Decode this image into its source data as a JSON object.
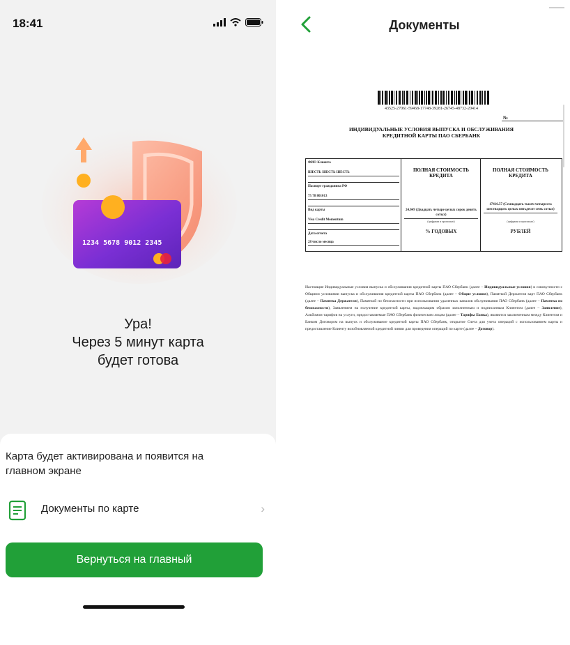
{
  "left_screen": {
    "status_bar": {
      "time": "18:41"
    },
    "hero": {
      "card_number": "1234  5678  9012  2345"
    },
    "headline": {
      "line1": "Ура!",
      "line2": "Через 5 минут карта",
      "line3": "будет готова"
    },
    "sheet": {
      "activation_text": "Карта будет активирована и появится на главном экране",
      "documents_label": "Документы по карте",
      "documents_chevron": "›",
      "cta_label": "Вернуться на главный"
    },
    "colors": {
      "accent": "#21a038",
      "background": "#f2f2f2"
    }
  },
  "right_screen": {
    "nav": {
      "back_icon": "‹",
      "title": "Документы"
    },
    "document": {
      "barcode_number": "43525-27061-59468-17748-39281-26745-48732-20414",
      "number_label": "№",
      "title_line1": "ИНДИВИДУАЛЬНЫЕ УСЛОВИЯ ВЫПУСКА И ОБСЛУЖИВАНИЯ",
      "title_line2": "КРЕДИТНОЙ КАРТЫ ПАО СБЕРБАНК",
      "fields": [
        {
          "key": "ФИО Клиента",
          "value": "ШЕСТЬ ШЕСТЬ ШЕСТЬ"
        },
        {
          "key": "Паспорт гражданина РФ",
          "value": "75 78 801013"
        },
        {
          "key": "Вид карты",
          "value": "Visa Credit Momentum"
        },
        {
          "key": "Дата отчета",
          "value": "28 число месяца"
        }
      ],
      "cost_percent": {
        "header": "ПОЛНАЯ СТОИМОСТЬ КРЕДИТА",
        "amount": "24.049 (Двадцать четыре целых сорок девять сотых)",
        "note": "(цифрами и прописью)",
        "unit": "% ГОДОВЫХ"
      },
      "cost_rub": {
        "header": "ПОЛНАЯ СТОИМОСТЬ КРЕДИТА",
        "amount": "17416.57 (Семнадцать тысяч четыреста шестнадцать целых пятьдесят семь сотых)",
        "note": "(цифрами и прописью)",
        "unit": "РУБЛЕЙ"
      },
      "body_parts": [
        {
          "t": "Настоящие Индивидуальные условия выпуска и обслуживания кредитной карты ПАО Сбербанк (далее – ",
          "b": false
        },
        {
          "t": "Индивидуальные условия",
          "b": true
        },
        {
          "t": ") в совокупности с Общими условиями выпуска и обслуживания кредитной карты ПАО Сбербанк (далее – ",
          "b": false
        },
        {
          "t": "Общие условия",
          "b": true
        },
        {
          "t": "), Памяткой Держателя карт ПАО Сбербанк (далее – ",
          "b": false
        },
        {
          "t": "Памятка Держателя",
          "b": true
        },
        {
          "t": "), Памяткой по безопасности при использовании удаленных каналов обслуживания ПАО Сбербанк (далее – ",
          "b": false
        },
        {
          "t": "Памятка по безопасности",
          "b": true
        },
        {
          "t": "), Заявлением на получение кредитной карты, надлежащим образом заполненным и подписанным Клиентом (далее – ",
          "b": false
        },
        {
          "t": "Заявление",
          "b": true
        },
        {
          "t": "), Альбомом тарифов на услуги, предоставляемые ПАО Сбербанк физическим лицам (далее – ",
          "b": false
        },
        {
          "t": "Тарифы Банка",
          "b": true
        },
        {
          "t": "), являются заключенным между Клиентом и Банком Договором на выпуск и обслуживание кредитной карты ПАО Сбербанк, открытие Счета для учета операций с использованием карты и предоставление Клиенту возобновляемой кредитной линии для проведения операций по карте (далее – ",
          "b": false
        },
        {
          "t": "Договор",
          "b": true
        },
        {
          "t": ").",
          "b": false
        }
      ]
    }
  }
}
